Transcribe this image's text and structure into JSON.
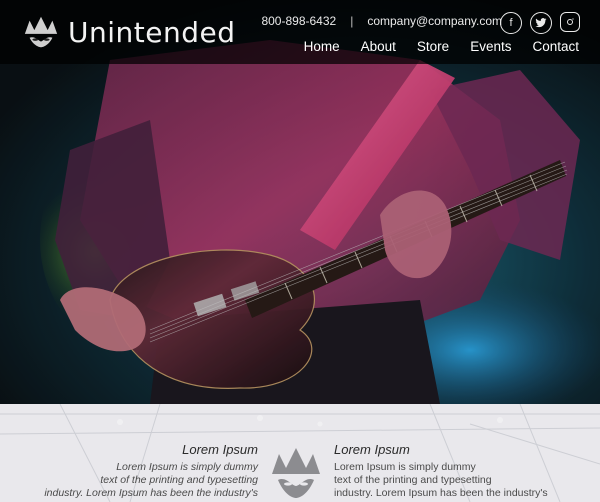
{
  "brand": {
    "name": "Unintended",
    "logo_icon": "crown-eyes-icon"
  },
  "contact": {
    "phone": "800-898-6432",
    "separator": "|",
    "email": "company@company.com"
  },
  "social": [
    {
      "name": "facebook-icon",
      "glyph": "f"
    },
    {
      "name": "twitter-icon",
      "glyph": "🐦"
    },
    {
      "name": "instagram-icon",
      "glyph": "◎"
    }
  ],
  "nav": {
    "home": "Home",
    "about": "About",
    "store": "Store",
    "events": "Events",
    "contact": "Contact"
  },
  "hero": {
    "image": "guitarist-on-stage"
  },
  "feature_left": {
    "title": "Lorem Ipsum",
    "line1": "Lorem Ipsum is simply dummy",
    "line2": "text of the printing and typesetting",
    "line3": "industry. Lorem Ipsum has been the industry's"
  },
  "feature_right": {
    "title": "Lorem Ipsum",
    "line1": "Lorem Ipsum is simply dummy",
    "line2": "text of the printing and typesetting",
    "line3": "industry. Lorem Ipsum has been the industry's"
  },
  "colors": {
    "header_bg": "#000000",
    "band_bg": "#e9e8ec",
    "accent": "#d63a7a"
  }
}
